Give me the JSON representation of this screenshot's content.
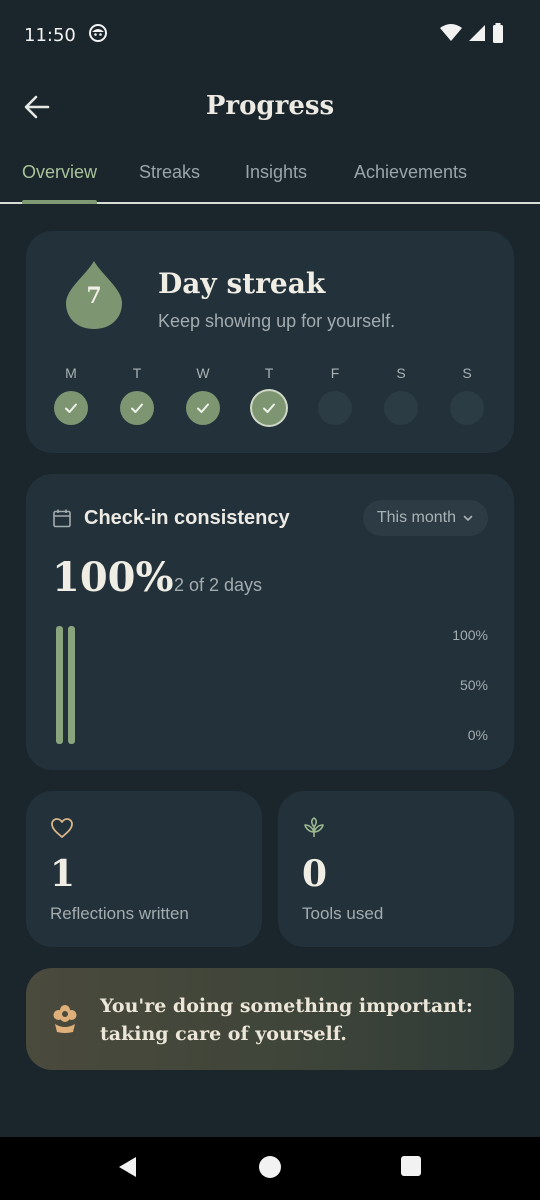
{
  "status": {
    "time": "11:50"
  },
  "header": {
    "title": "Progress"
  },
  "tabs": [
    {
      "label": "Overview",
      "active": true
    },
    {
      "label": "Streaks"
    },
    {
      "label": "Insights"
    },
    {
      "label": "Achievements"
    }
  ],
  "streak": {
    "count": "7",
    "title": "Day streak",
    "subtitle": "Keep showing up for yourself.",
    "days": [
      {
        "letter": "M",
        "state": "done"
      },
      {
        "letter": "T",
        "state": "done"
      },
      {
        "letter": "W",
        "state": "done"
      },
      {
        "letter": "T",
        "state": "today"
      },
      {
        "letter": "F",
        "state": "empty"
      },
      {
        "letter": "S",
        "state": "empty"
      },
      {
        "letter": "S",
        "state": "empty"
      }
    ]
  },
  "consistency": {
    "title": "Check-in consistency",
    "range": "This month",
    "percent": "100%",
    "days_text": "2 of 2 days",
    "y_labels": [
      "100%",
      "50%",
      "0%"
    ]
  },
  "chart_data": {
    "type": "bar",
    "values": [
      100,
      100
    ],
    "ylim": [
      0,
      100
    ],
    "yticks": [
      "0%",
      "50%",
      "100%"
    ]
  },
  "stats": {
    "reflections": {
      "value": "1",
      "label": "Reflections written"
    },
    "tools": {
      "value": "0",
      "label": "Tools used"
    }
  },
  "encouragement": {
    "text": "You're doing something important: taking care of yourself."
  },
  "colors": {
    "accent": "#7d9671",
    "background": "#1a252c",
    "card": "#22313a"
  }
}
